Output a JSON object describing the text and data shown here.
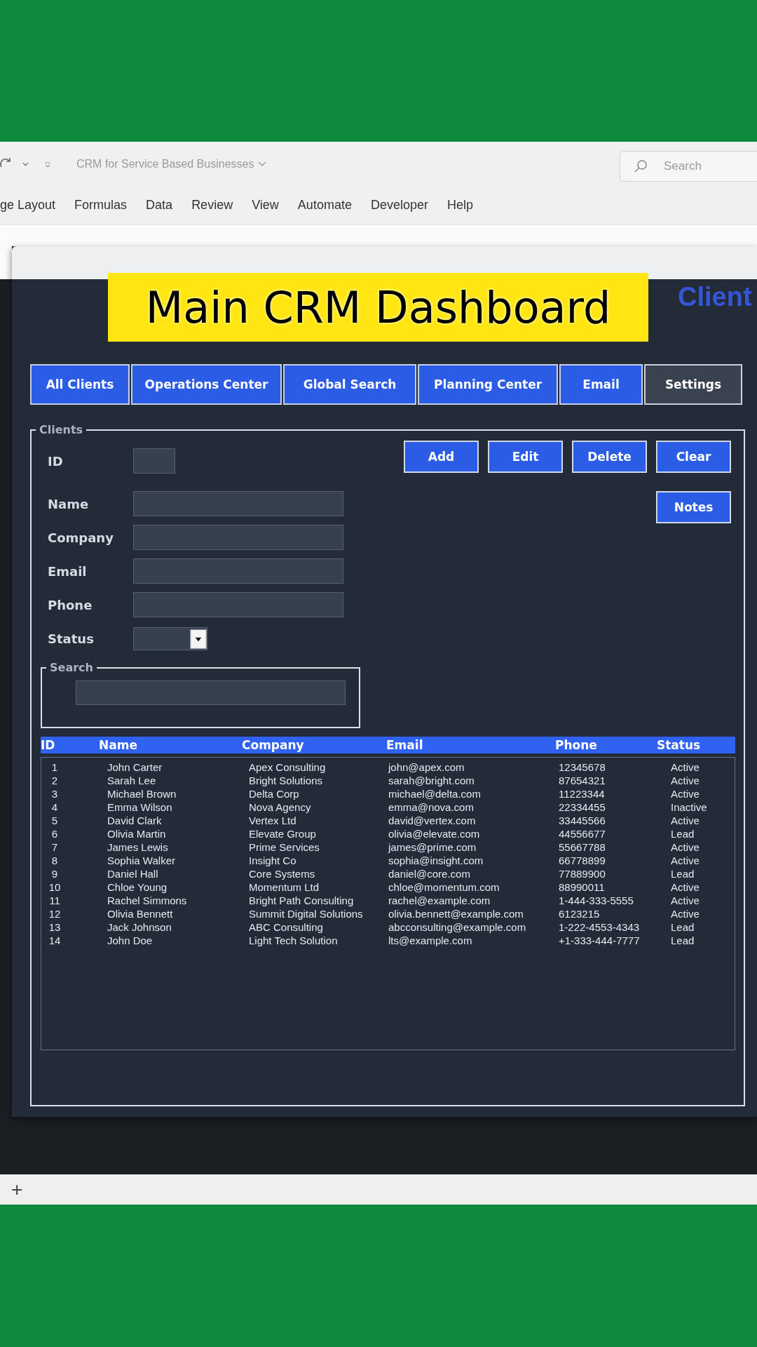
{
  "excel": {
    "document_title": "CRM for Service Based Businesses",
    "search": {
      "placeholder": "Search"
    },
    "ribbon_tabs": [
      "ge Layout",
      "Formulas",
      "Data",
      "Review",
      "View",
      "Automate",
      "Developer",
      "Help"
    ],
    "add_sheet": "+"
  },
  "caption": "Main CRM Dashboard",
  "form": {
    "heading": "Client",
    "tabs": [
      {
        "label": "All Clients",
        "selected": false
      },
      {
        "label": "Operations Center",
        "selected": false
      },
      {
        "label": "Global Search",
        "selected": false
      },
      {
        "label": "Planning Center",
        "selected": false
      },
      {
        "label": "Email",
        "selected": false
      },
      {
        "label": "Settings",
        "selected": true
      }
    ],
    "clients_frame": {
      "legend": "Clients",
      "fields": [
        {
          "label": "ID",
          "kind": "short"
        },
        {
          "label": "Name",
          "kind": "text"
        },
        {
          "label": "Company",
          "kind": "text"
        },
        {
          "label": "Email",
          "kind": "text"
        },
        {
          "label": "Phone",
          "kind": "text"
        },
        {
          "label": "Status",
          "kind": "select"
        }
      ],
      "actions": [
        "Add",
        "Edit",
        "Delete",
        "Clear"
      ],
      "notes_button": "Notes",
      "search": {
        "legend": "Search"
      },
      "table": {
        "columns": [
          "ID",
          "Name",
          "Company",
          "Email",
          "Phone",
          "Status"
        ],
        "rows": [
          [
            "1",
            "John Carter",
            "Apex Consulting",
            "john@apex.com",
            "12345678",
            "Active"
          ],
          [
            "2",
            "Sarah Lee",
            "Bright Solutions",
            "sarah@bright.com",
            "87654321",
            "Active"
          ],
          [
            "3",
            "Michael Brown",
            "Delta Corp",
            "michael@delta.com",
            "11223344",
            "Active"
          ],
          [
            "4",
            "Emma Wilson",
            "Nova Agency",
            "emma@nova.com",
            "22334455",
            "Inactive"
          ],
          [
            "5",
            "David Clark",
            "Vertex Ltd",
            "david@vertex.com",
            "33445566",
            "Active"
          ],
          [
            "6",
            "Olivia Martin",
            "Elevate Group",
            "olivia@elevate.com",
            "44556677",
            "Lead"
          ],
          [
            "7",
            "James Lewis",
            "Prime Services",
            "james@prime.com",
            "55667788",
            "Active"
          ],
          [
            "8",
            "Sophia Walker",
            "Insight Co",
            "sophia@insight.com",
            "66778899",
            "Active"
          ],
          [
            "9",
            "Daniel Hall",
            "Core Systems",
            "daniel@core.com",
            "77889900",
            "Lead"
          ],
          [
            "10",
            "Chloe Young",
            "Momentum Ltd",
            "chloe@momentum.com",
            "88990011",
            "Active"
          ],
          [
            "11",
            "Rachel Simmons",
            "Bright Path Consulting",
            "rachel@example.com",
            "1-444-333-5555",
            "Active"
          ],
          [
            "12",
            "Olivia Bennett",
            "Summit Digital Solutions",
            "olivia.bennett@example.com",
            "6123215",
            "Active"
          ],
          [
            "13",
            "Jack Johnson",
            "ABC Consulting",
            "abcconsulting@example.com",
            "1-222-4553-4343",
            "Lead"
          ],
          [
            "14",
            "John Doe",
            "Light Tech Solution",
            "lts@example.com",
            "+1-333-444-7777",
            "Lead"
          ]
        ]
      }
    }
  }
}
